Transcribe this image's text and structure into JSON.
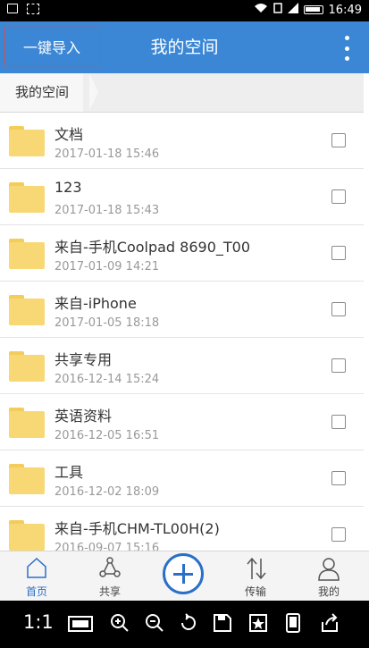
{
  "status_bar": {
    "time": "16:49"
  },
  "header": {
    "import_label": "一键导入",
    "title": "我的空间"
  },
  "breadcrumb": {
    "current": "我的空间"
  },
  "files": [
    {
      "name": "文档",
      "date": "2017-01-18 15:46"
    },
    {
      "name": "123",
      "date": "2017-01-18 15:43"
    },
    {
      "name": "来自-手机Coolpad 8690_T00",
      "date": "2017-01-09 14:21"
    },
    {
      "name": "来自-iPhone",
      "date": "2017-01-05 18:18"
    },
    {
      "name": "共享专用",
      "date": "2016-12-14 15:24"
    },
    {
      "name": "英语资料",
      "date": "2016-12-05 16:51"
    },
    {
      "name": "工具",
      "date": "2016-12-02 18:09"
    },
    {
      "name": "来自-手机CHM-TL00H(2)",
      "date": "2016-09-07 15:16"
    }
  ],
  "tabs": {
    "home": "首页",
    "share": "共享",
    "transfer": "传输",
    "mine": "我的"
  },
  "system_bar": {
    "ratio": "1:1"
  },
  "colors": {
    "accent": "#3b87d6",
    "tab_active": "#2a6fc8",
    "folder": "#f8d874"
  },
  "icons": [
    "home-icon",
    "share-icon",
    "add-icon",
    "transfer-icon",
    "user-icon",
    "more-vertical-icon",
    "folder-icon"
  ]
}
